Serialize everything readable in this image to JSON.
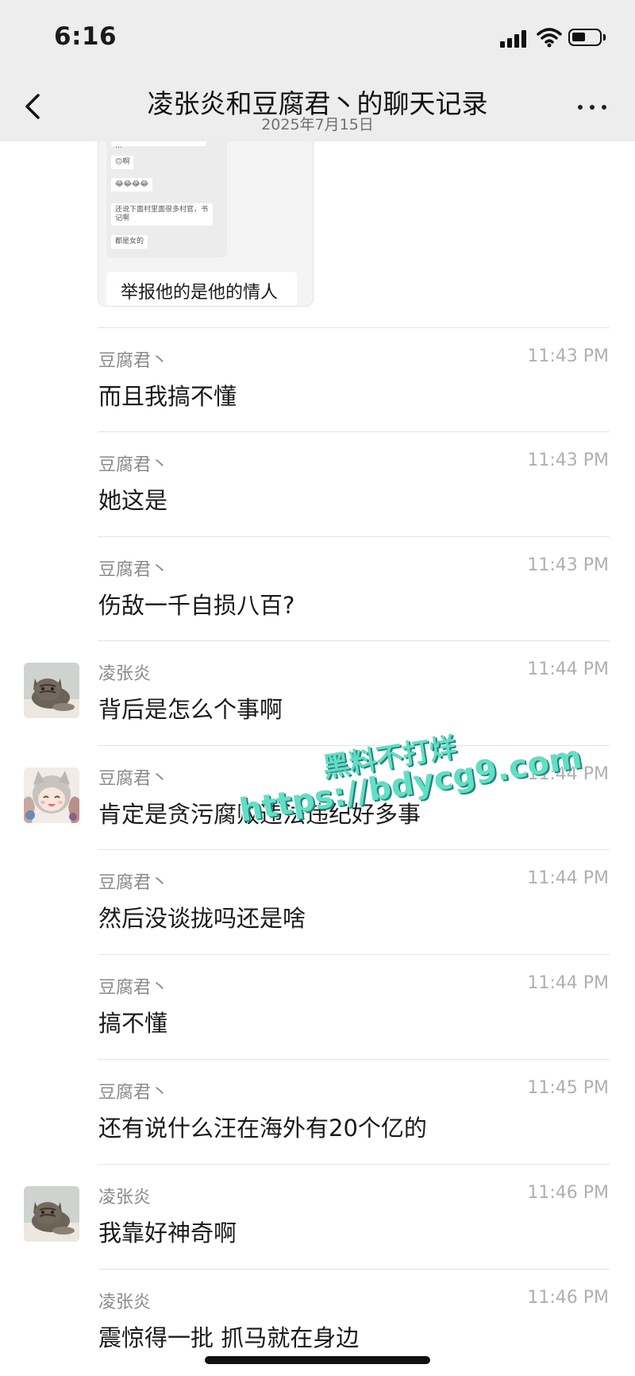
{
  "status_bar": {
    "time": "6:16"
  },
  "header": {
    "title": "凌张炎和豆腐君丶的聊天记录",
    "subtitle": "2025年7月15日"
  },
  "image_message": {
    "mini_lines": [
      "…",
      "🙃啊",
      "😂😂😂😂",
      "还说下面村里面很多村官，书记啊",
      "都是女的"
    ],
    "caption": "举报他的是他的情人"
  },
  "messages": [
    {
      "sender": "豆腐君丶",
      "time": "11:43 PM",
      "text": "而且我搞不懂",
      "avatar": ""
    },
    {
      "sender": "豆腐君丶",
      "time": "11:43 PM",
      "text": "她这是",
      "avatar": ""
    },
    {
      "sender": "豆腐君丶",
      "time": "11:43 PM",
      "text": "伤敌一千自损八百?",
      "avatar": ""
    },
    {
      "sender": "凌张炎",
      "time": "11:44 PM",
      "text": "背后是怎么个事啊",
      "avatar": "cat"
    },
    {
      "sender": "豆腐君丶",
      "time": "11:44 PM",
      "text": "肯定是贪污腐败违法违纪好多事",
      "avatar": "anime"
    },
    {
      "sender": "豆腐君丶",
      "time": "11:44 PM",
      "text": "然后没谈拢吗还是啥",
      "avatar": ""
    },
    {
      "sender": "豆腐君丶",
      "time": "11:44 PM",
      "text": "搞不懂",
      "avatar": ""
    },
    {
      "sender": "豆腐君丶",
      "time": "11:45 PM",
      "text": "还有说什么汪在海外有20个亿的",
      "avatar": ""
    },
    {
      "sender": "凌张炎",
      "time": "11:46 PM",
      "text": "我靠好神奇啊",
      "avatar": "cat"
    },
    {
      "sender": "凌张炎",
      "time": "11:46 PM",
      "text": "震惊得一批 抓马就在身边",
      "avatar": ""
    }
  ],
  "watermark": {
    "line1": "黑料不打烊",
    "line2": "https://bdycg9.com"
  },
  "colors": {
    "header_bg": "#ededed",
    "watermark": "#5fe0c6"
  }
}
